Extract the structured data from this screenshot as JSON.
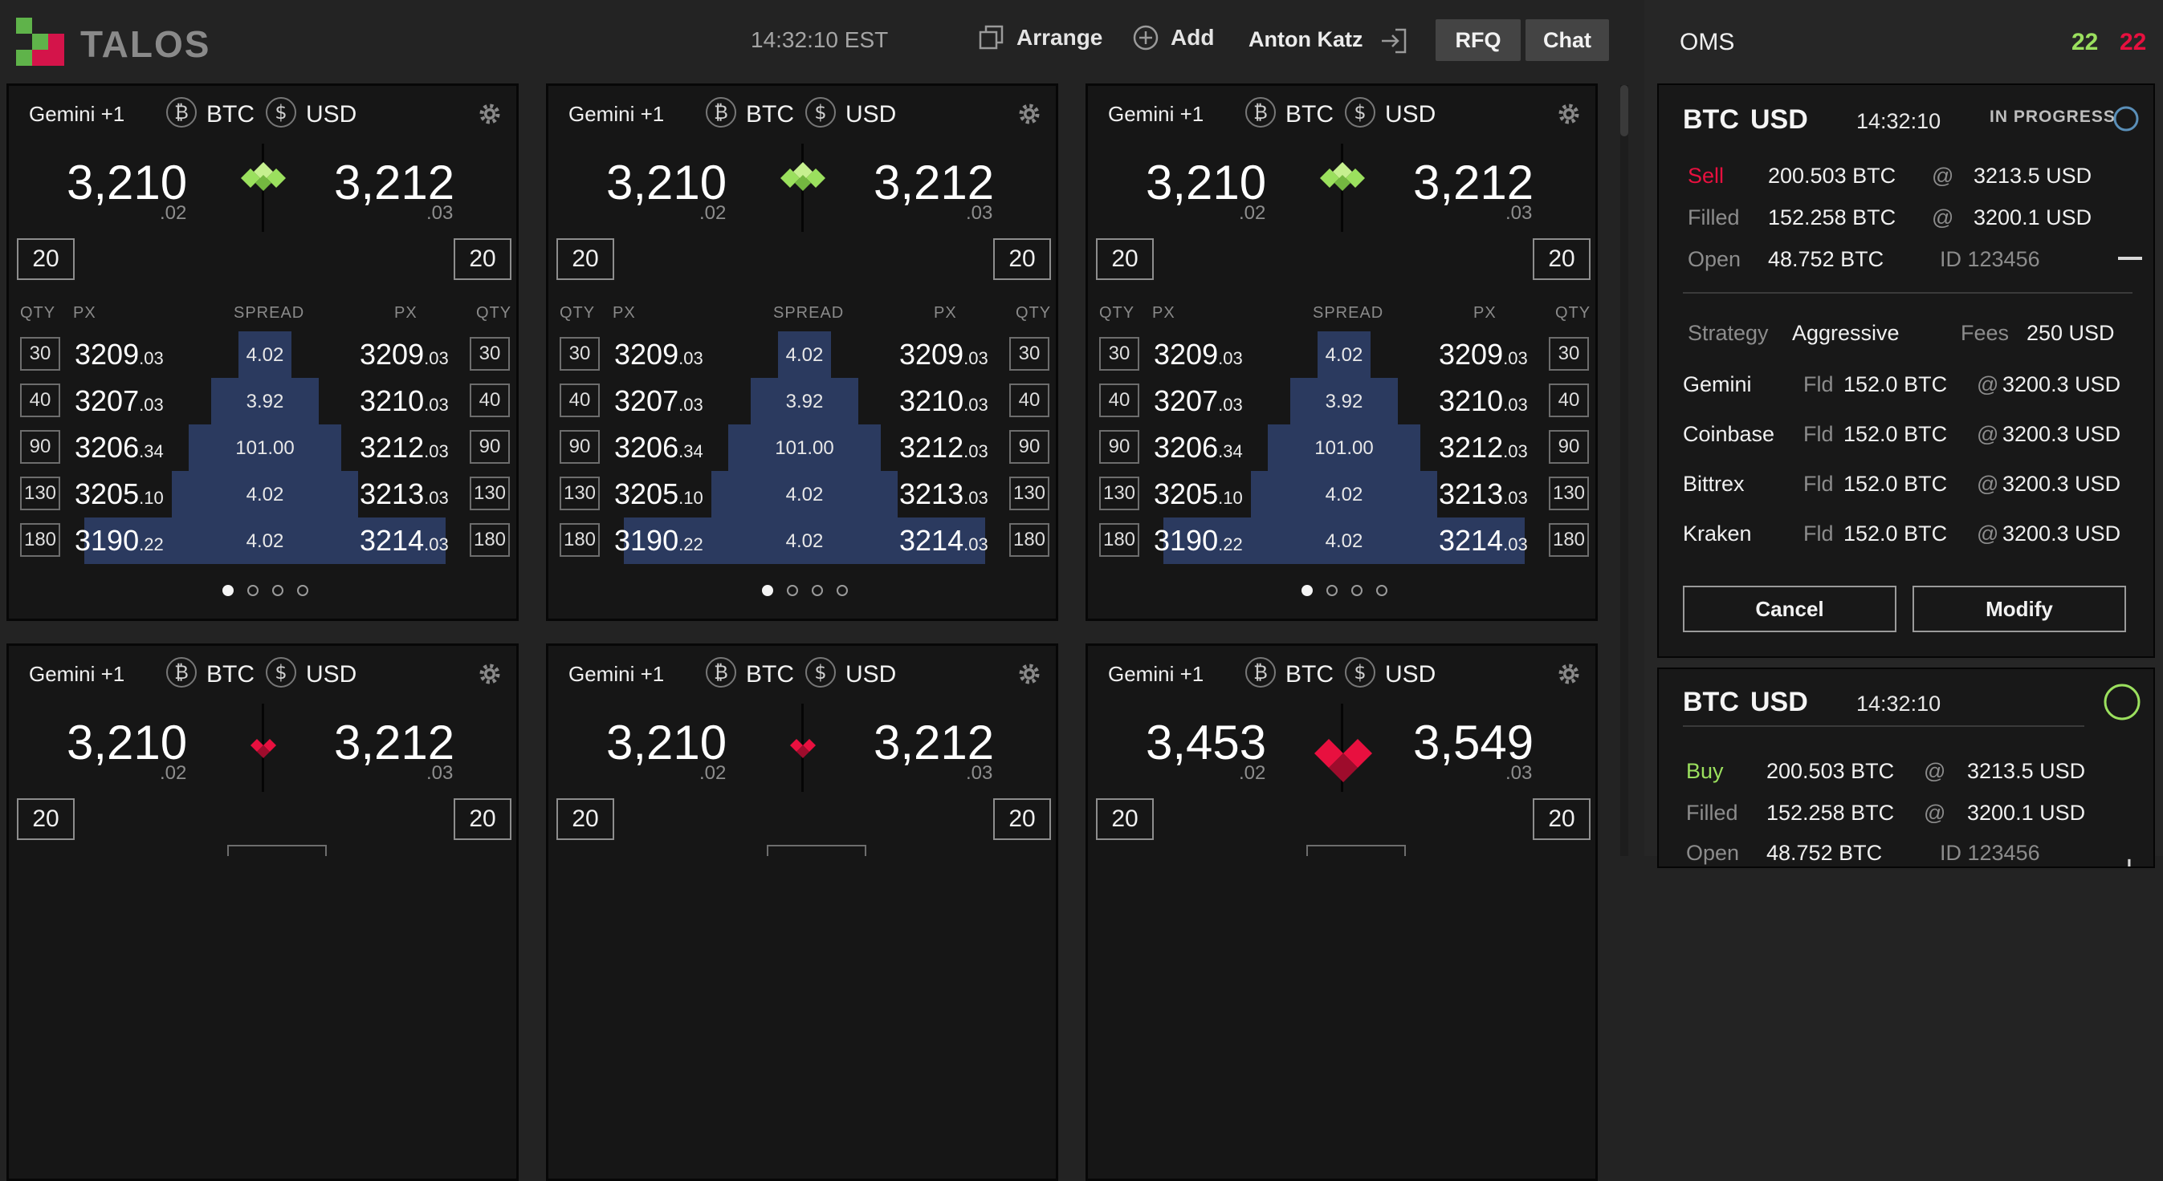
{
  "header": {
    "brand": "TALOS",
    "time": "14:32:10 EST",
    "arrange_label": "Arrange",
    "add_label": "Add",
    "user": "Anton Katz",
    "rfq_label": "RFQ",
    "chat_label": "Chat"
  },
  "tile_template": {
    "exchange": "Gemini +1",
    "base": "BTC",
    "quote": "USD",
    "qty_default": "20",
    "col_qty": "QTY",
    "col_px": "PX",
    "col_spread": "SPREAD"
  },
  "tiles": [
    {
      "bid_big": "3,210",
      "bid_dec": ".02",
      "ask_big": "3,212",
      "ask_dec": ".03",
      "direction": "up",
      "rows": [
        {
          "qty_l": "30",
          "bid": "3209",
          "bid_s": ".03",
          "spread": "4.02",
          "ask": "3209",
          "ask_s": ".03",
          "qty_r": "30"
        },
        {
          "qty_l": "40",
          "bid": "3207",
          "bid_s": ".03",
          "spread": "3.92",
          "ask": "3210",
          "ask_s": ".03",
          "qty_r": "40"
        },
        {
          "qty_l": "90",
          "bid": "3206",
          "bid_s": ".34",
          "spread": "101.00",
          "ask": "3212",
          "ask_s": ".03",
          "qty_r": "90"
        },
        {
          "qty_l": "130",
          "bid": "3205",
          "bid_s": ".10",
          "spread": "4.02",
          "ask": "3213",
          "ask_s": ".03",
          "qty_r": "130"
        },
        {
          "qty_l": "180",
          "bid": "3190",
          "bid_s": ".22",
          "spread": "4.02",
          "ask": "3214",
          "ask_s": ".03",
          "qty_r": "180"
        }
      ]
    },
    {
      "bid_big": "3,210",
      "bid_dec": ".02",
      "ask_big": "3,212",
      "ask_dec": ".03",
      "direction": "up",
      "rows": [
        {
          "qty_l": "30",
          "bid": "3209",
          "bid_s": ".03",
          "spread": "4.02",
          "ask": "3209",
          "ask_s": ".03",
          "qty_r": "30"
        },
        {
          "qty_l": "40",
          "bid": "3207",
          "bid_s": ".03",
          "spread": "3.92",
          "ask": "3210",
          "ask_s": ".03",
          "qty_r": "40"
        },
        {
          "qty_l": "90",
          "bid": "3206",
          "bid_s": ".34",
          "spread": "101.00",
          "ask": "3212",
          "ask_s": ".03",
          "qty_r": "90"
        },
        {
          "qty_l": "130",
          "bid": "3205",
          "bid_s": ".10",
          "spread": "4.02",
          "ask": "3213",
          "ask_s": ".03",
          "qty_r": "130"
        },
        {
          "qty_l": "180",
          "bid": "3190",
          "bid_s": ".22",
          "spread": "4.02",
          "ask": "3214",
          "ask_s": ".03",
          "qty_r": "180"
        }
      ]
    },
    {
      "bid_big": "3,210",
      "bid_dec": ".02",
      "ask_big": "3,212",
      "ask_dec": ".03",
      "direction": "up",
      "rows": [
        {
          "qty_l": "30",
          "bid": "3209",
          "bid_s": ".03",
          "spread": "4.02",
          "ask": "3209",
          "ask_s": ".03",
          "qty_r": "30"
        },
        {
          "qty_l": "40",
          "bid": "3207",
          "bid_s": ".03",
          "spread": "3.92",
          "ask": "3210",
          "ask_s": ".03",
          "qty_r": "40"
        },
        {
          "qty_l": "90",
          "bid": "3206",
          "bid_s": ".34",
          "spread": "101.00",
          "ask": "3212",
          "ask_s": ".03",
          "qty_r": "90"
        },
        {
          "qty_l": "130",
          "bid": "3205",
          "bid_s": ".10",
          "spread": "4.02",
          "ask": "3213",
          "ask_s": ".03",
          "qty_r": "130"
        },
        {
          "qty_l": "180",
          "bid": "3190",
          "bid_s": ".22",
          "spread": "4.02",
          "ask": "3214",
          "ask_s": ".03",
          "qty_r": "180"
        }
      ]
    },
    {
      "bid_big": "3,210",
      "bid_dec": ".02",
      "ask_big": "3,212",
      "ask_dec": ".03",
      "direction": "down"
    },
    {
      "bid_big": "3,210",
      "bid_dec": ".02",
      "ask_big": "3,212",
      "ask_dec": ".03",
      "direction": "down"
    },
    {
      "bid_big": "3,453",
      "bid_dec": ".02",
      "ask_big": "3,549",
      "ask_dec": ".03",
      "direction": "down-big"
    }
  ],
  "oms": {
    "title": "OMS",
    "count_green": "22",
    "count_red": "22",
    "orders": [
      {
        "base": "BTC",
        "quote": "USD",
        "time": "14:32:10",
        "status": "IN PROGRESS",
        "side": "Sell",
        "qty": "200.503 BTC",
        "at": "@",
        "price": "3213.5 USD",
        "filled_label": "Filled",
        "filled_qty": "152.258 BTC",
        "filled_price": "3200.1 USD",
        "open_label": "Open",
        "open_qty": "48.752 BTC",
        "id": "ID 123456",
        "strategy_label": "Strategy",
        "strategy": "Aggressive",
        "fees_label": "Fees",
        "fees": "250 USD",
        "fills": [
          {
            "venue": "Gemini",
            "fld": "Fld",
            "qty": "152.0 BTC",
            "at": "@",
            "price": "3200.3 USD"
          },
          {
            "venue": "Coinbase",
            "fld": "Fld",
            "qty": "152.0 BTC",
            "at": "@",
            "price": "3200.3 USD"
          },
          {
            "venue": "Bittrex",
            "fld": "Fld",
            "qty": "152.0 BTC",
            "at": "@",
            "price": "3200.3 USD"
          },
          {
            "venue": "Kraken",
            "fld": "Fld",
            "qty": "152.0 BTC",
            "at": "@",
            "price": "3200.3 USD"
          }
        ],
        "cancel_label": "Cancel",
        "modify_label": "Modify"
      },
      {
        "base": "BTC",
        "quote": "USD",
        "time": "14:32:10",
        "side": "Buy",
        "qty": "200.503 BTC",
        "at": "@",
        "price": "3213.5 USD",
        "filled_label": "Filled",
        "filled_qty": "152.258 BTC",
        "filled_price": "3200.1 USD",
        "open_label": "Open",
        "open_qty": "48.752 BTC",
        "id": "ID 123456"
      }
    ]
  },
  "colors": {
    "green": "#9be05e",
    "red": "#e8103f",
    "panel": "#262626",
    "tile": "#161616",
    "pyramid": "#2b3a5f"
  }
}
